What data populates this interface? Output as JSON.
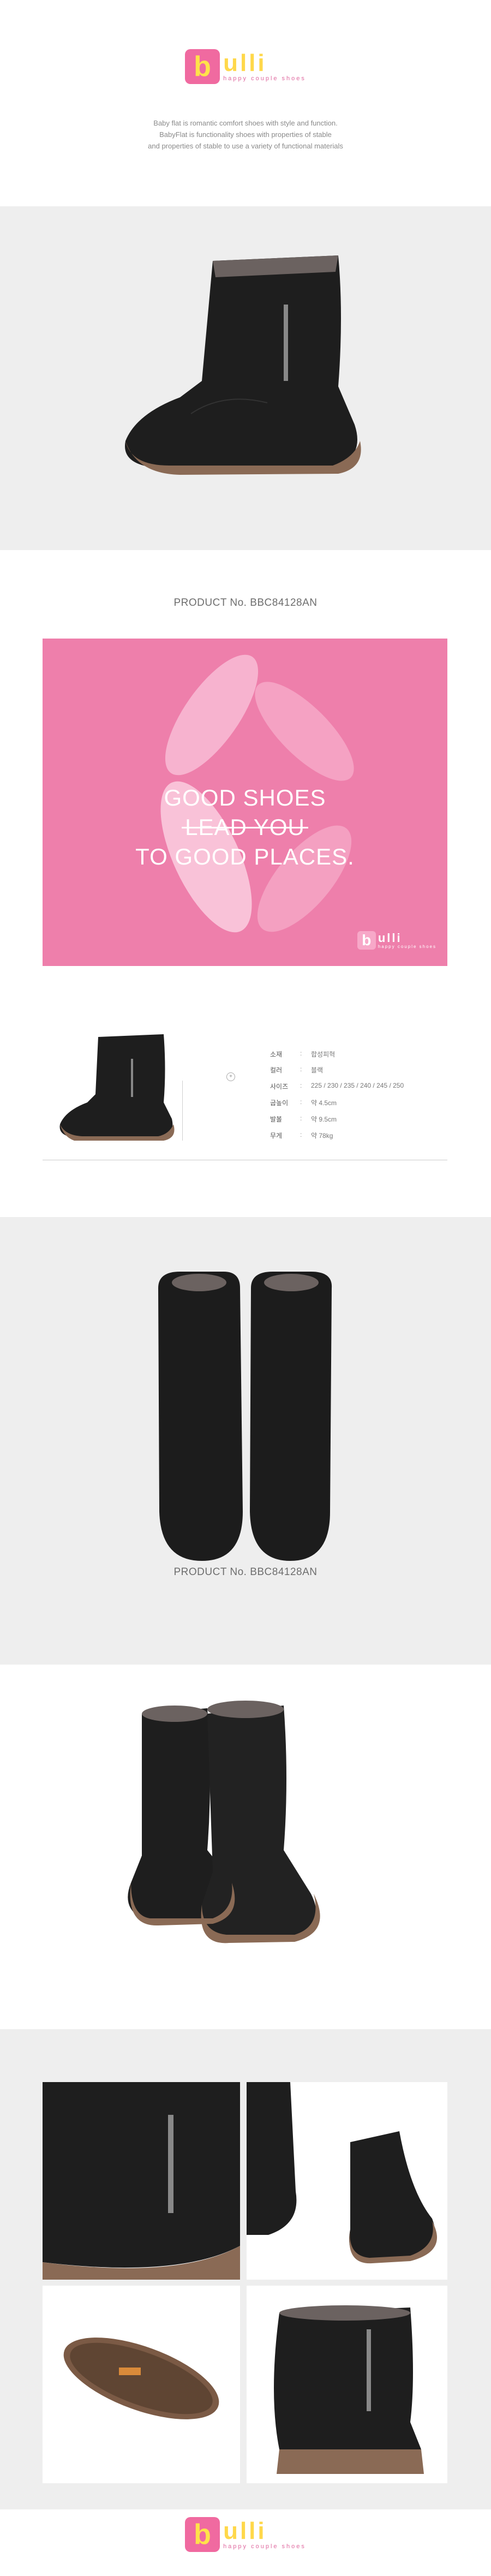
{
  "brand": {
    "logo_letter": "b",
    "logo_text": "ulli",
    "tagline": "happy couple shoes"
  },
  "intro": {
    "line1": "Baby flat is romantic comfort shoes with style and function.",
    "line2": "BabyFlat is functionality shoes with properties of stable",
    "line3": "and properties of stable to use a variety of functional materials"
  },
  "product_no_1": "PRODUCT No. BBC84128AN",
  "banner": {
    "line1": "GOOD SHOES",
    "line2": "LEAD YOU",
    "line3": "TO GOOD PLACES.",
    "mini_logo_letter": "b",
    "mini_logo_text": "ulli",
    "mini_tagline": "happy couple shoes"
  },
  "specs": [
    {
      "key": "소재",
      "value": "합성피혁"
    },
    {
      "key": "컬러",
      "value": "블랙"
    },
    {
      "key": "사이즈",
      "value": "225 / 230 / 235 / 240 / 245 / 250"
    },
    {
      "key": "굽높이",
      "value": "약 4.5cm"
    },
    {
      "key": "발볼",
      "value": "약 9.5cm"
    },
    {
      "key": "무게",
      "value": "약 78kg"
    }
  ],
  "product_no_2": "PRODUCT No. BBC84128AN",
  "footer_brand": {
    "logo_letter": "b",
    "logo_text": "ulli",
    "tagline": "happy couple shoes"
  },
  "colors": {
    "brand_pink": "#f06aa0",
    "brand_yellow": "#ffd84a",
    "banner_pink": "#ee7fab",
    "band_grey": "#eeeeee"
  }
}
